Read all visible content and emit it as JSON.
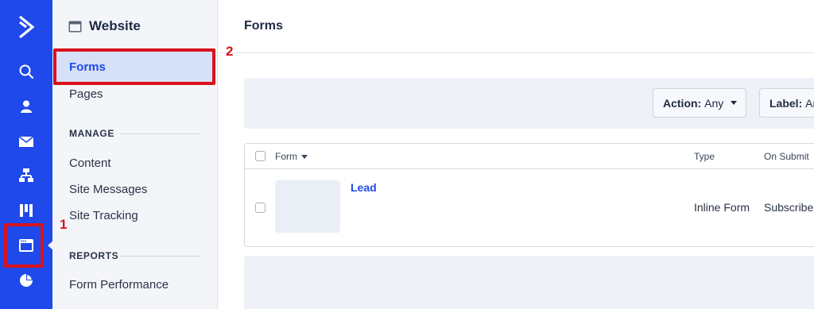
{
  "rail": {
    "icons": [
      "activecampaign-logo-icon",
      "search-icon",
      "contacts-icon",
      "campaigns-envelope-icon",
      "automations-icon",
      "deals-pipeline-icon",
      "website-icon",
      "reports-pie-icon"
    ],
    "active": "website-icon"
  },
  "sidebar": {
    "header_title": "Website",
    "items_top": [
      {
        "label": "Forms",
        "active": true
      },
      {
        "label": "Pages",
        "active": false
      }
    ],
    "manage_heading": "MANAGE",
    "manage_items": [
      {
        "label": "Content"
      },
      {
        "label": "Site Messages"
      },
      {
        "label": "Site Tracking"
      }
    ],
    "reports_heading": "REPORTS",
    "reports_items": [
      {
        "label": "Form Performance"
      }
    ]
  },
  "annotations": {
    "one": "1",
    "two": "2",
    "color": "#d8121b"
  },
  "main": {
    "title": "Forms",
    "filters": {
      "action_label": "Action:",
      "action_value": "Any",
      "label_label": "Label:",
      "label_value": "Any"
    },
    "table": {
      "headers": {
        "form": "Form",
        "type": "Type",
        "on_submit": "On Submit"
      },
      "rows": [
        {
          "name": "Lead",
          "type": "Inline Form",
          "on_submit": "Subscribe"
        }
      ]
    }
  },
  "colors": {
    "brand_blue": "#1f49ea",
    "sidebar_bg": "#f3f5f9",
    "active_item_bg": "#d6e0f6"
  }
}
